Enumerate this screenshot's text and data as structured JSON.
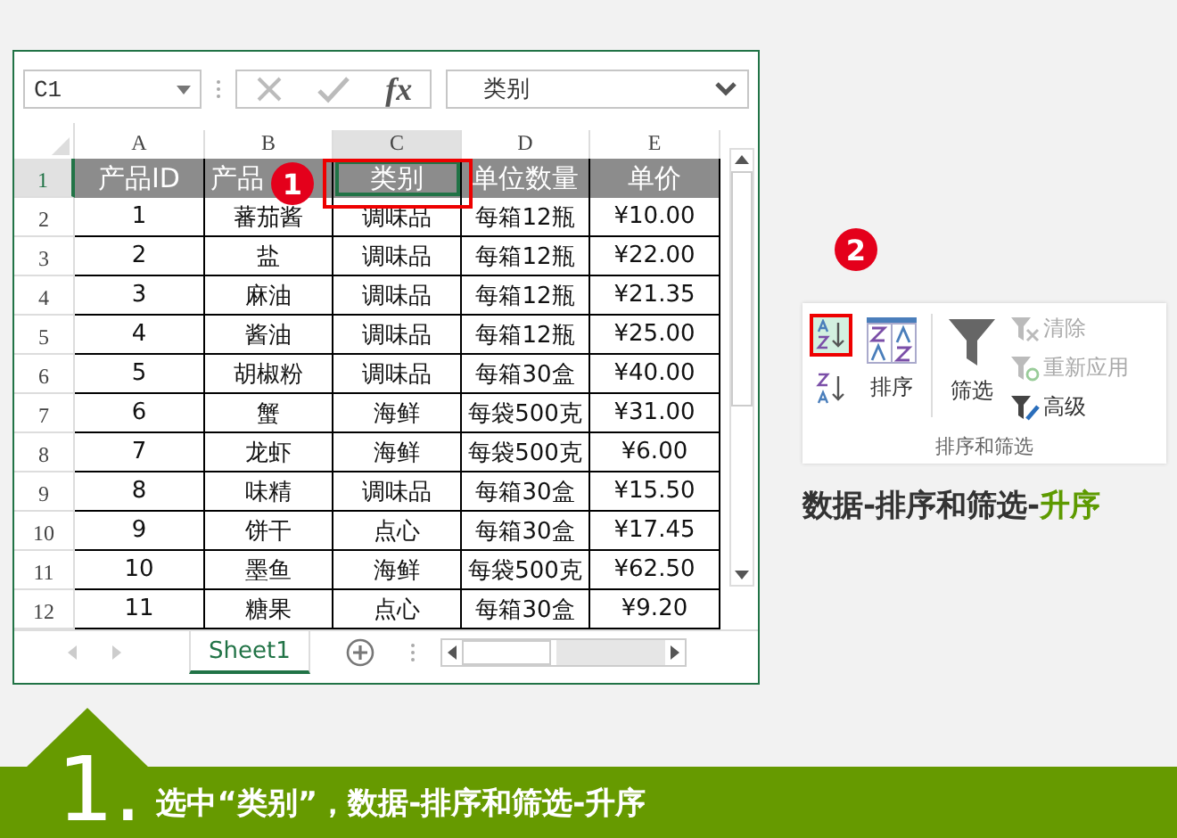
{
  "formula_bar": {
    "name_box": "C1",
    "function_label": "fx",
    "value": "类别"
  },
  "columns": [
    {
      "label": "A",
      "selected": false
    },
    {
      "label": "B",
      "selected": false
    },
    {
      "label": "C",
      "selected": true
    },
    {
      "label": "D",
      "selected": false
    },
    {
      "label": "E",
      "selected": false
    }
  ],
  "rows": [
    {
      "number": "1",
      "selected": true,
      "kind": "header",
      "cells": [
        "产品ID",
        "产品",
        "类别",
        "单位数量",
        "单价"
      ]
    },
    {
      "number": "2",
      "selected": false,
      "kind": "data",
      "cells": [
        "1",
        "蕃茄酱",
        "调味品",
        "每箱12瓶",
        "¥10.00"
      ]
    },
    {
      "number": "3",
      "selected": false,
      "kind": "data",
      "cells": [
        "2",
        "盐",
        "调味品",
        "每箱12瓶",
        "¥22.00"
      ]
    },
    {
      "number": "4",
      "selected": false,
      "kind": "data",
      "cells": [
        "3",
        "麻油",
        "调味品",
        "每箱12瓶",
        "¥21.35"
      ]
    },
    {
      "number": "5",
      "selected": false,
      "kind": "data",
      "cells": [
        "4",
        "酱油",
        "调味品",
        "每箱12瓶",
        "¥25.00"
      ]
    },
    {
      "number": "6",
      "selected": false,
      "kind": "data",
      "cells": [
        "5",
        "胡椒粉",
        "调味品",
        "每箱30盒",
        "¥40.00"
      ]
    },
    {
      "number": "7",
      "selected": false,
      "kind": "data",
      "cells": [
        "6",
        "蟹",
        "海鲜",
        "每袋500克",
        "¥31.00"
      ]
    },
    {
      "number": "8",
      "selected": false,
      "kind": "data",
      "cells": [
        "7",
        "龙虾",
        "海鲜",
        "每袋500克",
        "¥6.00"
      ]
    },
    {
      "number": "9",
      "selected": false,
      "kind": "data",
      "cells": [
        "8",
        "味精",
        "调味品",
        "每箱30盒",
        "¥15.50"
      ]
    },
    {
      "number": "10",
      "selected": false,
      "kind": "data",
      "cells": [
        "9",
        "饼干",
        "点心",
        "每箱30盒",
        "¥17.45"
      ]
    },
    {
      "number": "11",
      "selected": false,
      "kind": "data",
      "cells": [
        "10",
        "墨鱼",
        "海鲜",
        "每袋500克",
        "¥62.50"
      ]
    },
    {
      "number": "12",
      "selected": false,
      "kind": "data",
      "cells": [
        "11",
        "糖果",
        "点心",
        "每箱30盒",
        "¥9.20"
      ]
    }
  ],
  "sheet_tabs": [
    {
      "label": "Sheet1",
      "selected": true
    }
  ],
  "step_badges": [
    "1",
    "2"
  ],
  "ribbon": {
    "group_label": "排序和筛选",
    "buttons": [
      {
        "kind": "sort_asc",
        "selected": true
      },
      {
        "kind": "sort_desc",
        "selected": false
      },
      {
        "kind": "sort",
        "label": "排序",
        "selected": false
      },
      {
        "kind": "filter",
        "label": "筛选",
        "selected": false
      },
      {
        "kind": "clear",
        "label": "清除",
        "disabled": true
      },
      {
        "kind": "reapply",
        "label": "重新应用",
        "disabled": true
      },
      {
        "kind": "advanced",
        "label": "高级",
        "disabled": false
      }
    ]
  },
  "caption": [
    {
      "text": "数据-排序和筛选-",
      "highlight": false
    },
    {
      "text": "升序",
      "highlight": true
    }
  ],
  "banner": {
    "number": "1.",
    "text": "选中“类别”，数据-排序和筛选-升序"
  }
}
